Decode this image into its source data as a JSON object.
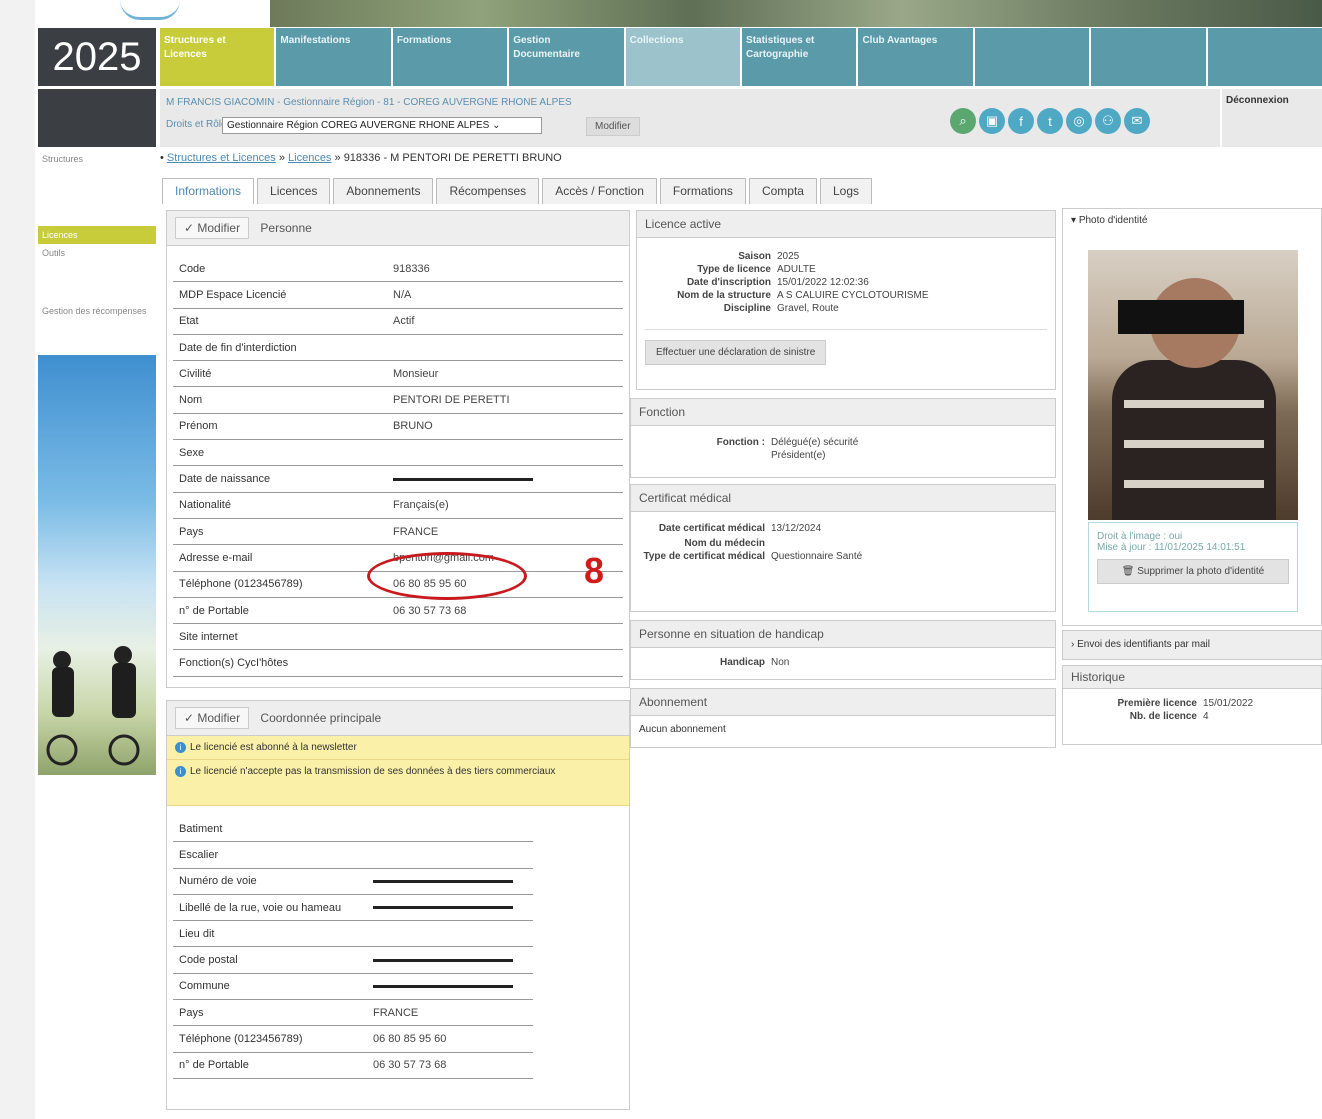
{
  "header": {
    "year": "2025"
  },
  "nav": [
    {
      "label": "Structures et Licences",
      "active": true
    },
    {
      "label": "Manifestations"
    },
    {
      "label": "Formations"
    },
    {
      "label": "Gestion Documentaire"
    },
    {
      "label": "Collections",
      "light": true
    },
    {
      "label": "Statistiques et Cartographie"
    },
    {
      "label": "Club Avantages"
    },
    {
      "label": ""
    },
    {
      "label": ""
    },
    {
      "label": ""
    }
  ],
  "user": {
    "line1": "M FRANCIS GIACOMIN - Gestionnaire Région - 81 - COREG AUVERGNE RHONE ALPES",
    "role_label": "Droits et Rôle :",
    "role_value": "Gestionnaire Région COREG AUVERGNE RHONE ALPES",
    "modify": "Modifier",
    "logout": "Déconnexion"
  },
  "sidebar": {
    "top": "Structures",
    "items": [
      "Licences",
      "Outils",
      "Gestion des récompenses"
    ]
  },
  "breadcrumb": {
    "part1": "Structures et Licences",
    "sep1": "»",
    "part2": "Licences",
    "sep2": "»",
    "current": "918336 - M PENTORI DE PERETTI BRUNO"
  },
  "tabs": [
    "Informations",
    "Licences",
    "Abonnements",
    "Récompenses",
    "Accès / Fonction",
    "Formations",
    "Compta",
    "Logs"
  ],
  "personne": {
    "modify": "Modifier",
    "title": "Personne",
    "rows": [
      {
        "k": "Code",
        "v": "918336"
      },
      {
        "k": "MDP Espace Licencié",
        "v": "N/A"
      },
      {
        "k": "Etat",
        "v": "Actif"
      },
      {
        "k": "Date de fin d'interdiction",
        "v": ""
      },
      {
        "k": "Civilité",
        "v": "Monsieur"
      },
      {
        "k": "Nom",
        "v": "PENTORI DE PERETTI"
      },
      {
        "k": "Prénom",
        "v": "BRUNO"
      },
      {
        "k": "Sexe",
        "v": ""
      },
      {
        "k": "Date de naissance",
        "v": "",
        "redacted": true
      },
      {
        "k": "Nationalité",
        "v": "Français(e)"
      },
      {
        "k": "Pays",
        "v": "FRANCE"
      },
      {
        "k": "Adresse e-mail",
        "v": "bpentori@gmail.com"
      },
      {
        "k": "Téléphone (0123456789)",
        "v": "06 80 85 95 60"
      },
      {
        "k": "n° de Portable",
        "v": "06 30 57 73 68"
      },
      {
        "k": "Site internet",
        "v": ""
      },
      {
        "k": "Fonction(s) CycI'hôtes",
        "v": ""
      }
    ]
  },
  "annotation": "8",
  "coord": {
    "modify": "Modifier",
    "title": "Coordonnée principale",
    "info1": "Le licencié est abonné à la newsletter",
    "info2": "Le licencié n'accepte pas la transmission de ses données à des tiers commerciaux",
    "rows": [
      {
        "k": "Batiment",
        "v": ""
      },
      {
        "k": "Escalier",
        "v": ""
      },
      {
        "k": "Numéro de voie",
        "v": "",
        "redacted": true
      },
      {
        "k": "Libellé de la rue, voie ou hameau",
        "v": "",
        "redacted": true
      },
      {
        "k": "Lieu dit",
        "v": ""
      },
      {
        "k": "Code postal",
        "v": "",
        "redacted": true
      },
      {
        "k": "Commune",
        "v": "",
        "redacted": true
      },
      {
        "k": "Pays",
        "v": "FRANCE"
      },
      {
        "k": "Téléphone (0123456789)",
        "v": "06 80 85 95 60"
      },
      {
        "k": "n° de Portable",
        "v": "06 30 57 73 68"
      }
    ]
  },
  "licence": {
    "title": "Licence active",
    "rows": [
      {
        "k": "Saison",
        "v": "2025"
      },
      {
        "k": "Type de licence",
        "v": "ADULTE"
      },
      {
        "k": "Date d'inscription",
        "v": "15/01/2022 12:02:36"
      },
      {
        "k": "Nom de la structure",
        "v": "A S CALUIRE CYCLOTOURISME"
      },
      {
        "k": "Discipline",
        "v": "Gravel, Route"
      }
    ],
    "button": "Effectuer une déclaration de sinistre"
  },
  "fonction": {
    "title": "Fonction",
    "k": "Fonction :",
    "v1": "Délégué(e) sécurité",
    "v2": "Président(e)"
  },
  "certificat": {
    "title": "Certificat médical",
    "rows": [
      {
        "k": "Date certificat médical",
        "v": "13/12/2024"
      },
      {
        "k": "Nom du médecin",
        "v": ""
      },
      {
        "k": "Type de certificat médical",
        "v": "Questionnaire Santé"
      }
    ]
  },
  "handicap": {
    "title": "Personne en situation de handicap",
    "k": "Handicap",
    "v": "Non"
  },
  "abonnement": {
    "title": "Abonnement",
    "v": "Aucun abonnement"
  },
  "photo": {
    "title": "Photo d'identité",
    "droit": "Droit à l'image : oui",
    "maj": "Mise à jour : 11/01/2025 14:01:51",
    "delete": "Supprimer la photo d'identité"
  },
  "envoi": "Envoi des identifiants par mail",
  "historique": {
    "title": "Historique",
    "rows": [
      {
        "k": "Première licence",
        "v": "15/01/2022"
      },
      {
        "k": "Nb. de licence",
        "v": "4"
      }
    ]
  }
}
